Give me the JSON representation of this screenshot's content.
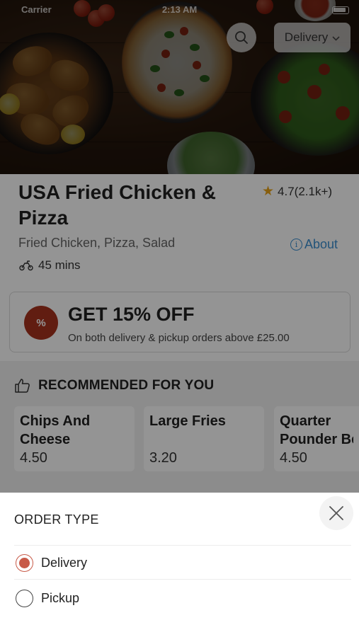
{
  "status_bar": {
    "carrier": "Carrier",
    "time": "2:13 AM"
  },
  "header": {
    "delivery_button": "Delivery",
    "search_icon": "search-icon",
    "chevron_icon": "chevron-down-icon"
  },
  "store": {
    "name": "USA Fried Chicken & Pizza",
    "rating": "4.7(2.1k+)",
    "cuisines": "Fried Chicken, Pizza, Salad",
    "about_label": "About",
    "eta": "45 mins"
  },
  "offer": {
    "badge": "%",
    "title": "GET 15% OFF",
    "subtitle": "On both delivery & pickup orders above £25.00"
  },
  "recommended": {
    "heading": "RECOMMENDED FOR YOU",
    "items": [
      {
        "name_line1": "Chips And",
        "name_line2": "Cheese",
        "price": "4.50"
      },
      {
        "name_line1": "Large Fries",
        "name_line2": "",
        "price": "3.20"
      },
      {
        "name_line1": "Quarter",
        "name_line2": "Pounder Be",
        "price": "4.50"
      }
    ]
  },
  "order_type_sheet": {
    "title": "ORDER TYPE",
    "options": [
      {
        "label": "Delivery",
        "selected": true
      },
      {
        "label": "Pickup",
        "selected": false
      }
    ]
  },
  "colors": {
    "accent": "#c85a48",
    "offer_badge": "#a7331e",
    "link": "#3b8fd1",
    "star": "#e8a317"
  }
}
